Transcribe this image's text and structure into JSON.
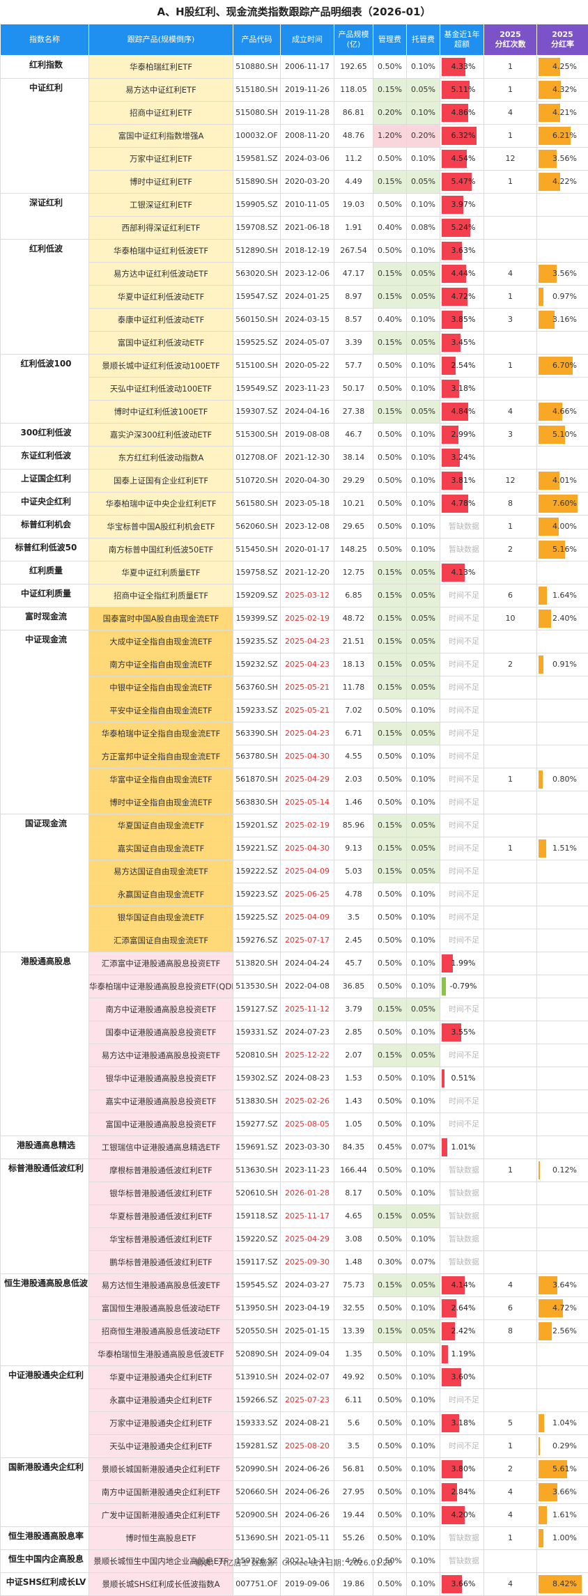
{
  "title": "A、H股红利、现金流类指数跟踪产品明细表（2026-01）",
  "headers": {
    "index_name": "指数名称",
    "product": "跟踪产品(规模倒序)",
    "code": "产品代码",
    "date": "成立时间",
    "size": "产品规模\n(亿)",
    "mgmt": "管理费",
    "custody": "托管费",
    "excess": "基金近1年\n超额",
    "div_count": "2025\n分红次数",
    "div_rate": "2025\n分红率"
  },
  "colors": {
    "header_blue": "#1f8ff0",
    "header_purple": "#7b52c8",
    "excess_positive": "#f43f4f",
    "excess_negative": "#8bc34a",
    "dividend_bar": "#f9a825",
    "new_date_red": "#e53030"
  },
  "groups": [
    {
      "name": "红利指数",
      "bg": "#fff3c4",
      "rows": [
        [
          "华泰柏瑞红利ETF",
          "510880.SH",
          "2006-11-17",
          false,
          "192.65",
          "0.50%",
          "0.10%",
          "4.33%",
          4.33,
          "1",
          "4.25%",
          4.25
        ]
      ]
    },
    {
      "name": "中证红利",
      "bg": "#fff3c4",
      "rows": [
        [
          "易方达中证红利ETF",
          "515180.SH",
          "2019-11-26",
          false,
          "118.05",
          "0.15%",
          "0.05%",
          "5.11%",
          5.11,
          "1",
          "4.32%",
          4.32
        ],
        [
          "招商中证红利ETF",
          "515080.SH",
          "2019-11-28",
          false,
          "86.81",
          "0.20%",
          "0.10%",
          "4.86%",
          4.86,
          "4",
          "4.21%",
          4.21
        ],
        [
          "富国中证红利指数增强A",
          "100032.OF",
          "2008-11-20",
          false,
          "48.76",
          "1.20%",
          "0.20%",
          "6.32%",
          6.32,
          "1",
          "6.21%",
          6.21
        ],
        [
          "万家中证红利ETF",
          "159581.SZ",
          "2024-03-06",
          false,
          "11.2",
          "0.50%",
          "0.10%",
          "4.54%",
          4.54,
          "12",
          "3.56%",
          3.56
        ],
        [
          "博时中证红利ETF",
          "515890.SH",
          "2020-03-20",
          false,
          "4.49",
          "0.15%",
          "0.05%",
          "5.47%",
          5.47,
          "1",
          "4.22%",
          4.22
        ]
      ]
    },
    {
      "name": "深证红利",
      "bg": "#fff3c4",
      "rows": [
        [
          "工银深证红利ETF",
          "159905.SZ",
          "2010-11-05",
          false,
          "19.03",
          "0.50%",
          "0.10%",
          "3.97%",
          3.97,
          "",
          ""
        ],
        [
          "西部利得深证红利ETF",
          "159708.SZ",
          "2021-06-18",
          false,
          "1.91",
          "0.40%",
          "0.08%",
          "5.24%",
          5.24,
          "",
          ""
        ]
      ]
    },
    {
      "name": "红利低波",
      "bg": "#fff3c4",
      "rows": [
        [
          "华泰柏瑞中证红利低波ETF",
          "512890.SH",
          "2018-12-19",
          false,
          "267.54",
          "0.50%",
          "0.10%",
          "3.63%",
          3.63,
          "",
          ""
        ],
        [
          "易方达中证红利低波动ETF",
          "563020.SH",
          "2023-12-06",
          false,
          "47.17",
          "0.15%",
          "0.05%",
          "4.44%",
          4.44,
          "4",
          "3.56%",
          3.56
        ],
        [
          "华夏中证红利低波动ETF",
          "159547.SZ",
          "2024-01-25",
          false,
          "8.97",
          "0.15%",
          "0.05%",
          "4.72%",
          4.72,
          "1",
          "0.97%",
          0.97
        ],
        [
          "泰康中证红利低波动ETF",
          "560150.SH",
          "2024-03-15",
          false,
          "8.57",
          "0.40%",
          "0.10%",
          "3.85%",
          3.85,
          "3",
          "3.16%",
          3.16
        ],
        [
          "富国中证红利低波动ETF",
          "159525.SZ",
          "2024-05-07",
          false,
          "3.39",
          "0.15%",
          "0.05%",
          "3.45%",
          3.45,
          "",
          ""
        ]
      ]
    },
    {
      "name": "红利低波100",
      "bg": "#fff3c4",
      "rows": [
        [
          "景顺长城中证红利低波动100ETF",
          "515100.SH",
          "2020-05-22",
          false,
          "57.7",
          "0.50%",
          "0.10%",
          "2.54%",
          2.54,
          "1",
          "6.70%",
          6.7
        ],
        [
          "天弘中证红利低波动100ETF",
          "159549.SZ",
          "2023-11-23",
          false,
          "50.17",
          "0.50%",
          "0.10%",
          "3.18%",
          3.18,
          "",
          ""
        ],
        [
          "博时中证红利低波100ETF",
          "159307.SZ",
          "2024-04-16",
          false,
          "27.38",
          "0.15%",
          "0.05%",
          "4.84%",
          4.84,
          "4",
          "4.66%",
          4.66
        ]
      ]
    },
    {
      "name": "300红利低波",
      "bg": "#fff3c4",
      "rows": [
        [
          "嘉实沪深300红利低波动ETF",
          "515300.SH",
          "2019-08-08",
          false,
          "46.7",
          "0.50%",
          "0.10%",
          "2.99%",
          2.99,
          "3",
          "5.10%",
          5.1
        ]
      ]
    },
    {
      "name": "东证红利低波",
      "bg": "#fff3c4",
      "rows": [
        [
          "东方红红利低波动指数A",
          "012708.OF",
          "2021-12-30",
          false,
          "38.14",
          "0.50%",
          "0.10%",
          "3.24%",
          3.24,
          "",
          ""
        ]
      ]
    },
    {
      "name": "上证国企红利",
      "bg": "#fff3c4",
      "rows": [
        [
          "国泰上证国有企业红利ETF",
          "510720.SH",
          "2020-04-30",
          false,
          "29.29",
          "0.50%",
          "0.10%",
          "3.81%",
          3.81,
          "12",
          "4.01%",
          4.01
        ]
      ]
    },
    {
      "name": "中证央企红利",
      "bg": "#fff3c4",
      "rows": [
        [
          "华泰柏瑞中证中央企业红利ETF",
          "561580.SH",
          "2023-05-18",
          false,
          "10.21",
          "0.50%",
          "0.10%",
          "4.78%",
          4.78,
          "8",
          "7.60%",
          7.6
        ]
      ]
    },
    {
      "name": "标普红利机会",
      "bg": "#fff3c4",
      "rows": [
        [
          "华宝标普中国A股红利机会ETF",
          "562060.SH",
          "2023-12-08",
          false,
          "29.65",
          "0.50%",
          "0.10%",
          "暂缺数据",
          null,
          "1",
          "4.00%",
          4.0
        ]
      ]
    },
    {
      "name": "标普红利低波50",
      "bg": "#fff3c4",
      "rows": [
        [
          "南方标普中国红利低波50ETF",
          "515450.SH",
          "2020-01-17",
          false,
          "148.25",
          "0.50%",
          "0.10%",
          "暂缺数据",
          null,
          "2",
          "5.16%",
          5.16
        ]
      ]
    },
    {
      "name": "红利质量",
      "bg": "#fff3c4",
      "rows": [
        [
          "华夏中证红利质量ETF",
          "159758.SZ",
          "2021-12-20",
          false,
          "12.75",
          "0.15%",
          "0.05%",
          "4.13%",
          4.13,
          "",
          ""
        ]
      ]
    },
    {
      "name": "中证红利质量",
      "bg": "#fff3c4",
      "rows": [
        [
          "招商中证全指红利质量ETF",
          "159209.SZ",
          "2025-03-12",
          true,
          "6.85",
          "0.15%",
          "0.05%",
          "时间不足",
          null,
          "6",
          "1.64%",
          1.64
        ]
      ]
    },
    {
      "name": "富时现金流",
      "bg": "#ffd978",
      "rows": [
        [
          "国泰富时中国A股自由现金流ETF",
          "159399.SZ",
          "2025-02-19",
          true,
          "48.72",
          "0.15%",
          "0.05%",
          "时间不足",
          null,
          "10",
          "2.40%",
          2.4
        ]
      ]
    },
    {
      "name": "中证现金流",
      "bg": "#ffd978",
      "rows": [
        [
          "大成中证全指自由现金流ETF",
          "159235.SZ",
          "2025-04-23",
          true,
          "21.51",
          "0.15%",
          "0.05%",
          "时间不足",
          null,
          "",
          ""
        ],
        [
          "南方中证全指自由现金流ETF",
          "159232.SZ",
          "2025-04-23",
          true,
          "18.13",
          "0.15%",
          "0.05%",
          "时间不足",
          null,
          "2",
          "0.91%",
          0.91
        ],
        [
          "中银中证全指自由现金流ETF",
          "563760.SH",
          "2025-05-21",
          true,
          "11.78",
          "0.15%",
          "0.05%",
          "时间不足",
          null,
          "",
          ""
        ],
        [
          "平安中证全指自由现金流ETF",
          "159233.SZ",
          "2025-05-21",
          true,
          "7.02",
          "0.50%",
          "0.10%",
          "时间不足",
          null,
          "",
          ""
        ],
        [
          "华泰柏瑞中证全指自由现金流ETF",
          "563390.SH",
          "2025-04-23",
          true,
          "6.71",
          "0.15%",
          "0.05%",
          "时间不足",
          null,
          "",
          ""
        ],
        [
          "方正富邦中证全指自由现金流ETF",
          "563780.SH",
          "2025-04-30",
          true,
          "4.55",
          "0.50%",
          "0.10%",
          "时间不足",
          null,
          "",
          ""
        ],
        [
          "华富中证全指自由现金流ETF",
          "561870.SH",
          "2025-04-29",
          true,
          "2.03",
          "0.50%",
          "0.10%",
          "时间不足",
          null,
          "1",
          "0.80%",
          0.8
        ],
        [
          "博时中证全指自由现金流ETF",
          "563830.SH",
          "2025-05-14",
          true,
          "1.46",
          "0.50%",
          "0.10%",
          "时间不足",
          null,
          "",
          ""
        ]
      ]
    },
    {
      "name": "国证现金流",
      "bg": "#ffd978",
      "rows": [
        [
          "华夏国证自由现金流ETF",
          "159201.SZ",
          "2025-02-19",
          true,
          "85.96",
          "0.15%",
          "0.05%",
          "时间不足",
          null,
          "",
          ""
        ],
        [
          "嘉实国证自由现金流ETF",
          "159221.SZ",
          "2025-04-30",
          true,
          "9.13",
          "0.15%",
          "0.05%",
          "时间不足",
          null,
          "1",
          "1.51%",
          1.51
        ],
        [
          "易方达国证自由现金流ETF",
          "159222.SZ",
          "2025-04-09",
          true,
          "5.03",
          "0.15%",
          "0.05%",
          "时间不足",
          null,
          "",
          ""
        ],
        [
          "永赢国证自由现金流ETF",
          "159223.SZ",
          "2025-06-25",
          true,
          "4.78",
          "0.50%",
          "0.10%",
          "时间不足",
          null,
          "",
          ""
        ],
        [
          "银华国证自由现金流ETF",
          "159225.SZ",
          "2025-04-09",
          true,
          "3.5",
          "0.50%",
          "0.10%",
          "时间不足",
          null,
          "",
          ""
        ],
        [
          "汇添富国证自由现金流ETF",
          "159276.SZ",
          "2025-07-17",
          true,
          "2.45",
          "0.50%",
          "0.10%",
          "时间不足",
          null,
          "",
          ""
        ]
      ]
    },
    {
      "name": "港股通高股息",
      "bg": "#fde2ea",
      "rows": [
        [
          "汇添富中证港股通高股息投资ETF",
          "513820.SH",
          "2024-04-24",
          false,
          "45.7",
          "0.50%",
          "0.10%",
          "1.99%",
          1.99,
          "",
          ""
        ],
        [
          "华泰柏瑞中证港股通高股息投资ETF(QDII)",
          "513530.SH",
          "2022-04-08",
          false,
          "36.85",
          "0.50%",
          "0.10%",
          "-0.79%",
          -0.79,
          "",
          ""
        ],
        [
          "南方中证港股通高股息投资ETF",
          "159127.SZ",
          "2025-11-12",
          true,
          "3.79",
          "0.15%",
          "0.05%",
          "时间不足",
          null,
          "",
          ""
        ],
        [
          "国泰中证港股通高股息投资ETF",
          "159331.SZ",
          "2024-07-23",
          false,
          "2.85",
          "0.50%",
          "0.10%",
          "3.55%",
          3.55,
          "",
          ""
        ],
        [
          "易方达中证港股通高股息投资ETF",
          "520810.SH",
          "2025-12-22",
          true,
          "2.07",
          "0.15%",
          "0.05%",
          "时间不足",
          null,
          "",
          ""
        ],
        [
          "银华中证港股通高股息投资ETF",
          "159302.SZ",
          "2024-08-23",
          false,
          "1.53",
          "0.50%",
          "0.10%",
          "0.51%",
          0.51,
          "",
          ""
        ],
        [
          "嘉实中证港股通高股息投资ETF",
          "513830.SH",
          "2025-02-26",
          true,
          "1.43",
          "0.50%",
          "0.10%",
          "时间不足",
          null,
          "",
          ""
        ],
        [
          "富国中证港股通高股息投资ETF",
          "159277.SZ",
          "2025-08-05",
          true,
          "1.05",
          "0.50%",
          "0.10%",
          "时间不足",
          null,
          "",
          ""
        ]
      ]
    },
    {
      "name": "港股通高息精选",
      "bg": "#fde2ea",
      "rows": [
        [
          "工银瑞信中证港股通高息精选ETF",
          "159691.SZ",
          "2023-03-30",
          false,
          "84.35",
          "0.45%",
          "0.07%",
          "1.01%",
          1.01,
          "",
          ""
        ]
      ]
    },
    {
      "name": "标普港股通低波红利",
      "bg": "#fde2ea",
      "rows": [
        [
          "摩根标普港股通低波红利ETF",
          "513630.SH",
          "2023-11-23",
          false,
          "166.44",
          "0.50%",
          "0.10%",
          "暂缺数据",
          null,
          "1",
          "0.12%",
          0.12
        ],
        [
          "银华标普港股通低波红利ETF",
          "520610.SH",
          "2026-01-28",
          true,
          "8.17",
          "0.50%",
          "0.10%",
          "暂缺数据",
          null,
          "",
          ""
        ],
        [
          "华夏标普港股通低波红利ETF",
          "159118.SZ",
          "2025-11-17",
          true,
          "4.65",
          "0.15%",
          "0.05%",
          "暂缺数据",
          null,
          "",
          ""
        ],
        [
          "华宝标普港股通低波红利ETF",
          "159220.SZ",
          "2025-04-29",
          true,
          "3.08",
          "0.50%",
          "0.10%",
          "暂缺数据",
          null,
          "",
          ""
        ],
        [
          "鹏华标普港股通低波红利ETF",
          "159117.SZ",
          "2025-09-30",
          true,
          "1.48",
          "0.30%",
          "0.07%",
          "暂缺数据",
          null,
          "",
          ""
        ]
      ]
    },
    {
      "name": "恒生港股通高股息低波",
      "bg": "#fde2ea",
      "rows": [
        [
          "易方达恒生港股通高股息低波ETF",
          "159545.SZ",
          "2024-03-27",
          false,
          "75.73",
          "0.15%",
          "0.05%",
          "4.14%",
          4.14,
          "4",
          "3.64%",
          3.64
        ],
        [
          "富国恒生港股通高股息低波动ETF",
          "513950.SH",
          "2023-04-19",
          false,
          "32.55",
          "0.50%",
          "0.10%",
          "2.64%",
          2.64,
          "6",
          "4.72%",
          4.72
        ],
        [
          "招商恒生港股通高股息低波动ETF",
          "520550.SH",
          "2025-01-15",
          false,
          "13.39",
          "0.15%",
          "0.05%",
          "2.42%",
          2.42,
          "8",
          "2.56%",
          2.56
        ],
        [
          "华泰柏瑞恒生港股通高股息低波ETF",
          "520890.SH",
          "2024-09-04",
          false,
          "1.35",
          "0.50%",
          "0.10%",
          "1.19%",
          1.19,
          "",
          ""
        ]
      ]
    },
    {
      "name": "中证港股通央企红利",
      "bg": "#fde2ea",
      "rows": [
        [
          "华夏中证港股通央企红利ETF",
          "513910.SH",
          "2024-02-07",
          false,
          "49.92",
          "0.50%",
          "0.10%",
          "3.60%",
          3.6,
          "",
          ""
        ],
        [
          "永赢中证港股通央企红利ETF",
          "159266.SZ",
          "2025-07-23",
          true,
          "6.11",
          "0.50%",
          "0.10%",
          "时间不足",
          null,
          "",
          ""
        ],
        [
          "万家中证港股通央企红利ETF",
          "159333.SZ",
          "2024-08-21",
          false,
          "5.6",
          "0.50%",
          "0.10%",
          "3.18%",
          3.18,
          "5",
          "1.04%",
          1.04
        ],
        [
          "天弘中证港股通央企红利ETF",
          "159281.SZ",
          "2025-08-20",
          true,
          "3.5",
          "0.50%",
          "0.10%",
          "时间不足",
          null,
          "1",
          "0.29%",
          0.29
        ]
      ]
    },
    {
      "name": "国新港股通央企红利",
      "bg": "#fde2ea",
      "rows": [
        [
          "景顺长城国新港股通央企红利ETF",
          "520990.SH",
          "2024-06-26",
          false,
          "56.81",
          "0.50%",
          "0.10%",
          "3.80%",
          3.8,
          "2",
          "5.61%",
          5.61
        ],
        [
          "南方中证国新港股通央企红利ETF",
          "520660.SH",
          "2024-06-26",
          false,
          "27.95",
          "0.50%",
          "0.10%",
          "2.84%",
          2.84,
          "4",
          "3.66%",
          3.66
        ],
        [
          "广发中证国新港股通央企红利ETF",
          "520900.SH",
          "2024-06-26",
          false,
          "19.44",
          "0.50%",
          "0.10%",
          "4.20%",
          4.2,
          "4",
          "1.61%",
          1.61
        ]
      ]
    },
    {
      "name": "恒生港股通高股息率",
      "bg": "#fde2ea",
      "rows": [
        [
          "博时恒生高股息ETF",
          "513690.SH",
          "2021-05-11",
          false,
          "55.26",
          "0.50%",
          "0.10%",
          "暂缺数据",
          null,
          "1",
          "1.00%",
          1.0
        ]
      ]
    },
    {
      "name": "恒生中国内企高股息",
      "bg": "#fde2ea",
      "rows": [
        [
          "景顺长城恒生中国内地企业高股息ETF",
          "159726.SZ",
          "2021-11-11",
          false,
          "4.96",
          "0.50%",
          "0.10%",
          "暂缺数据",
          null,
          "",
          ""
        ]
      ]
    },
    {
      "name": "中证SHS红利成长LV",
      "bg": "#fde2ea",
      "rows": [
        [
          "景顺长城SHS红利成长低波指数A",
          "007751.OF",
          "2019-09-06",
          false,
          "19.86",
          "0.50%",
          "0.10%",
          "3.66%",
          3.66,
          "4",
          "8.42%",
          8.42
        ]
      ]
    }
  ],
  "footer": "制表：六亿居士 数据源：Choice 统计日期：2026.01.28"
}
